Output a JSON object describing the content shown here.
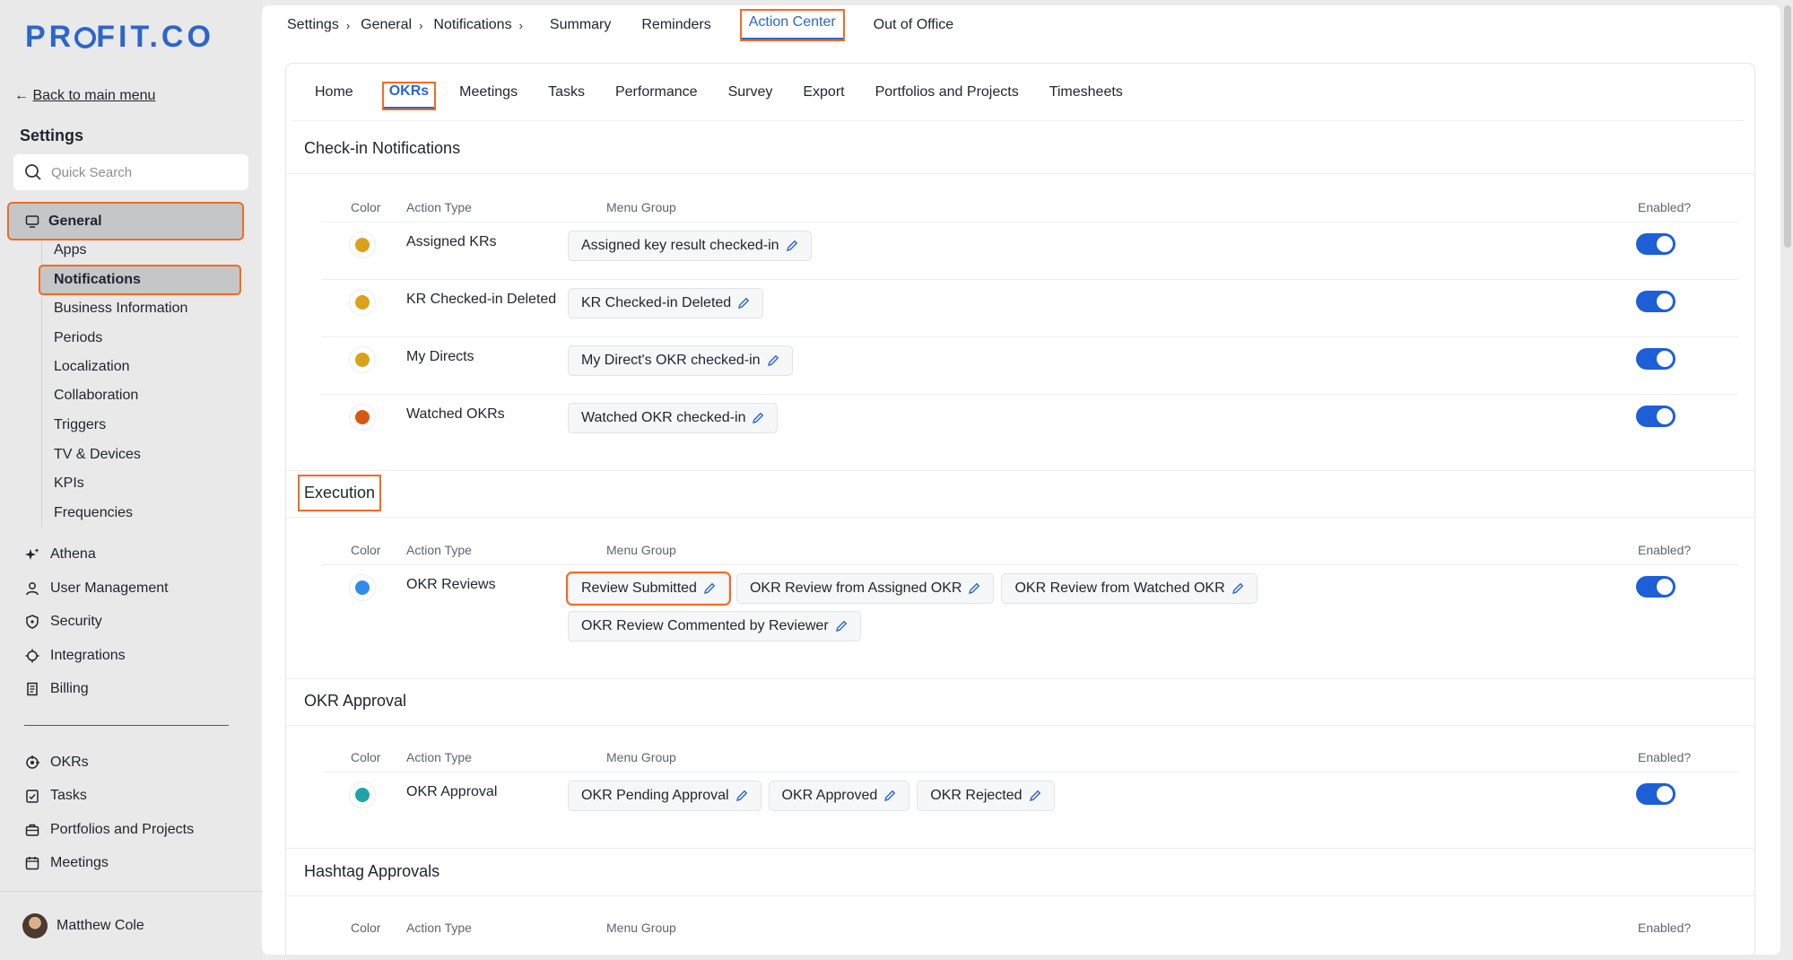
{
  "app": {
    "logo": "PR",
    "logo_rest": "FIT.CO"
  },
  "sidebar": {
    "back": "Back to main menu",
    "title": "Settings",
    "search_placeholder": "Quick Search",
    "general": "General",
    "sub_items": [
      "Apps",
      "Notifications",
      "Business Information",
      "Periods",
      "Localization",
      "Collaboration",
      "Triggers",
      "TV & Devices",
      "KPIs",
      "Frequencies"
    ],
    "main_items": [
      {
        "label": "Athena",
        "icon": "sparkle-icon"
      },
      {
        "label": "User Management",
        "icon": "user-icon"
      },
      {
        "label": "Security",
        "icon": "shield-icon"
      },
      {
        "label": "Integrations",
        "icon": "puzzle-icon"
      },
      {
        "label": "Billing",
        "icon": "receipt-icon"
      }
    ],
    "app_items": [
      {
        "label": "OKRs",
        "icon": "target-icon"
      },
      {
        "label": "Tasks",
        "icon": "checklist-icon"
      },
      {
        "label": "Portfolios and Projects",
        "icon": "briefcase-icon"
      },
      {
        "label": "Meetings",
        "icon": "calendar-icon"
      }
    ],
    "user": "Matthew Cole"
  },
  "topnav": {
    "crumbs": [
      "Settings",
      "General",
      "Notifications"
    ],
    "tabs": [
      "Summary",
      "Reminders",
      "Action Center",
      "Out of Office"
    ],
    "active_tab": "Action Center"
  },
  "subtabs": [
    "Home",
    "OKRs",
    "Meetings",
    "Tasks",
    "Performance",
    "Survey",
    "Export",
    "Portfolios and Projects",
    "Timesheets"
  ],
  "table_headers": {
    "color": "Color",
    "action_type": "Action Type",
    "menu_group": "Menu Group",
    "enabled": "Enabled?"
  },
  "sections": [
    {
      "title": "Check-in Notifications",
      "rows": [
        {
          "action_type": "Assigned KRs",
          "color": "#d9a21a",
          "chips": [
            "Assigned key result checked-in"
          ],
          "enabled": true
        },
        {
          "action_type": "KR Checked-in Deleted",
          "color": "#d9a21a",
          "chips": [
            "KR Checked-in Deleted"
          ],
          "enabled": true
        },
        {
          "action_type": "My Directs",
          "color": "#d9a21a",
          "chips": [
            "My Direct's OKR checked-in"
          ],
          "enabled": true
        },
        {
          "action_type": "Watched OKRs",
          "color": "#d9580f",
          "chips": [
            "Watched OKR checked-in"
          ],
          "enabled": true
        }
      ]
    },
    {
      "title": "Execution",
      "rows": [
        {
          "action_type": "OKR Reviews",
          "color": "#2e8cf0",
          "chips": [
            "Review Submitted",
            "OKR Review from Assigned OKR",
            "OKR Review from Watched OKR",
            "OKR Review Commented by Reviewer"
          ],
          "enabled": true
        }
      ]
    },
    {
      "title": "OKR Approval",
      "rows": [
        {
          "action_type": "OKR Approval",
          "color": "#1fa3a8",
          "chips": [
            "OKR Pending Approval",
            "OKR Approved",
            "OKR Rejected"
          ],
          "enabled": true
        }
      ]
    },
    {
      "title": "Hashtag Approvals",
      "rows": []
    }
  ],
  "colors": {
    "accent": "#2c66c9",
    "toggle_on": "#1d5fd6",
    "highlight": "#f26b21"
  }
}
